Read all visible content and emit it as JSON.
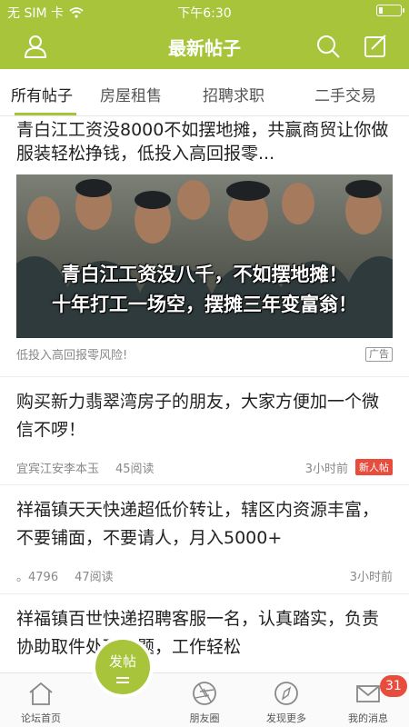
{
  "status_bar": {
    "carrier": "无 SIM 卡",
    "time": "下午6:30"
  },
  "header": {
    "title": "最新帖子",
    "left_icon": "user-icon",
    "right_icons": [
      "search-icon",
      "compose-icon"
    ]
  },
  "tabs": [
    {
      "label": "所有帖子",
      "active": true
    },
    {
      "label": "房屋租售",
      "active": false
    },
    {
      "label": "招聘求职",
      "active": false
    },
    {
      "label": "二手交易",
      "active": false
    }
  ],
  "ad": {
    "title": "青白江工资没8000不如摆地摊，共赢商贸让你做服装轻松挣钱，低投入高回报零...",
    "banner_line1": "青白江工资没八千，不如摆地摊！",
    "banner_line2": "十年打工一场空，摆摊三年变富翁！",
    "caption": "低投入高回报零风险!",
    "badge": "广告"
  },
  "posts": [
    {
      "title": "购买新力翡翠湾房子的朋友，大家方便加一个微信不啰！",
      "author": "宜宾江安李本玉",
      "reads": "45阅读",
      "time": "3小时前",
      "badge": "新人帖"
    },
    {
      "title": "祥福镇天天快递超低价转让，辖区内资源丰富，不要铺面，不要请人，月入5000+",
      "author": "。4796",
      "reads": "47阅读",
      "time": "3小时前"
    },
    {
      "title": "祥福镇百世快递招聘客服一名，认真踏实，负责协助取件处理问题，工作轻松"
    }
  ],
  "bottom_nav": {
    "home": "论坛首页",
    "post_button": "发帖",
    "moments": "朋友圈",
    "discover": "发现更多",
    "messages": "我的消息",
    "message_count": "31"
  },
  "colors": {
    "brand": "#a7c43a",
    "badge_red": "#e74c3c"
  }
}
